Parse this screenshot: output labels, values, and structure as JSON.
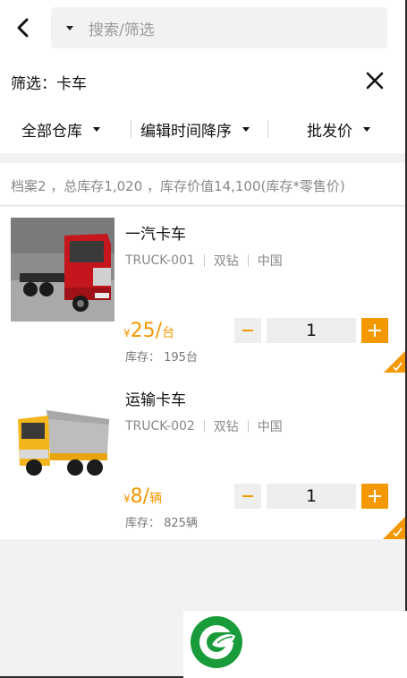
{
  "header": {
    "search_placeholder": "搜索/筛选"
  },
  "filter": {
    "label": "筛选：卡车"
  },
  "sort": {
    "warehouse": "全部仓库",
    "order": "编辑时间降序",
    "price_type": "批发价"
  },
  "summary": {
    "text": "档案2 ，总库存1,020 ，库存价值14,100(库存*零售价)"
  },
  "products": [
    {
      "name": "一汽卡车",
      "code": "TRUCK-001",
      "brand": "双钻",
      "origin": "中国",
      "currency": "¥",
      "price": "25",
      "slash": "/",
      "unit": "台",
      "stock": "库存： 195台",
      "qty": "1"
    },
    {
      "name": "运输卡车",
      "code": "TRUCK-002",
      "brand": "双钻",
      "origin": "中国",
      "currency": "¥",
      "price": "8",
      "slash": "/",
      "unit": "辆",
      "stock": "库存： 825辆",
      "qty": "1"
    }
  ],
  "colors": {
    "accent": "#f39800",
    "brand_green": "#1a9b3a",
    "background": "#f2f2f2"
  },
  "icons": [
    "back-arrow-icon",
    "caret-down-icon",
    "close-icon",
    "minus-icon",
    "plus-icon",
    "check-corner-icon",
    "app-logo"
  ]
}
